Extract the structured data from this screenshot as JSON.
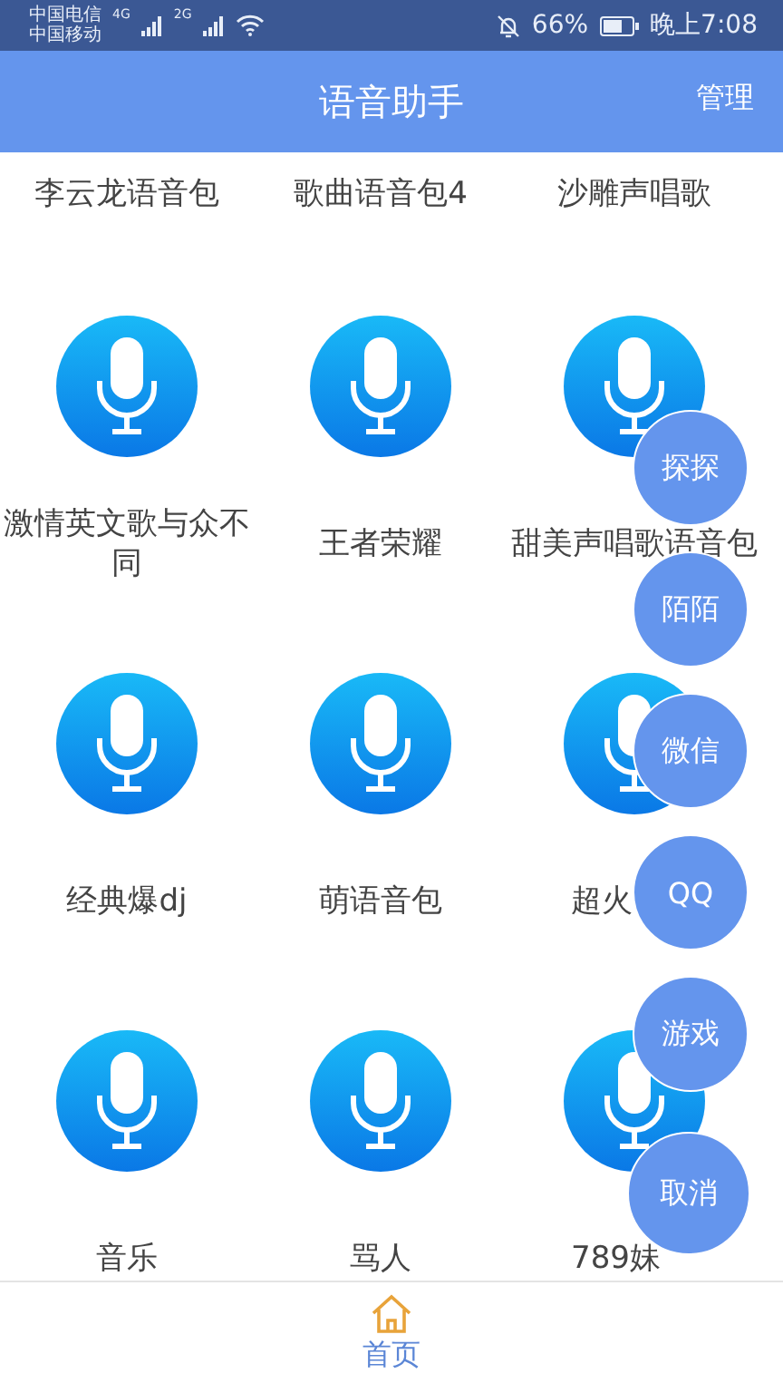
{
  "status_bar": {
    "carriers": [
      "中国电信",
      "中国移动"
    ],
    "network_1": "4G",
    "network_2": "2G",
    "battery": "66%",
    "time": "晚上7:08"
  },
  "header": {
    "title": "语音助手",
    "action": "管理"
  },
  "top_row": [
    "李云龙语音包",
    "歌曲语音包4",
    "沙雕声唱歌"
  ],
  "packs": [
    {
      "label": "激情英文歌与众不同"
    },
    {
      "label": "王者荣耀"
    },
    {
      "label": "甜美声唱歌语音包"
    },
    {
      "label": "经典爆dj"
    },
    {
      "label": "萌语音包"
    },
    {
      "label": "超火"
    },
    {
      "label": "音乐"
    },
    {
      "label": "骂人"
    },
    {
      "label": "789妹"
    }
  ],
  "share_menu": [
    {
      "label": "探探",
      "kind": "option"
    },
    {
      "label": "陌陌",
      "kind": "option"
    },
    {
      "label": "微信",
      "kind": "option"
    },
    {
      "label": "QQ",
      "kind": "option"
    },
    {
      "label": "游戏",
      "kind": "option"
    },
    {
      "label": "取消",
      "kind": "cancel"
    }
  ],
  "bottom_nav": [
    {
      "label": "首页",
      "selected": true
    }
  ]
}
